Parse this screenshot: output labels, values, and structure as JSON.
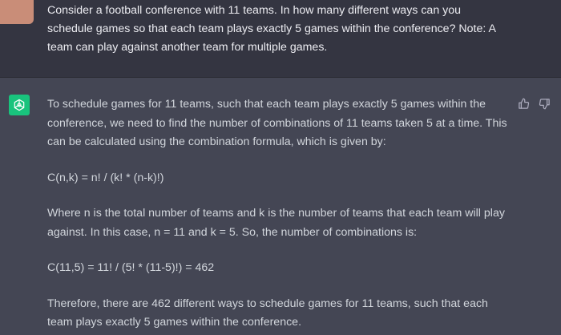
{
  "user_message": {
    "lines": [
      "Consider a football conference with 11 teams. In how many different ways can you",
      "schedule games so that each team plays exactly 5 games within the conference? Note: A",
      "team can play against another team for multiple games."
    ]
  },
  "assistant_message": {
    "paragraphs": [
      "To schedule games for 11 teams, such that each team plays exactly 5 games within the conference, we need to find the number of combinations of 11 teams taken 5 at a time. This can be calculated using the combination formula, which is given by:",
      "C(n,k) = n! / (k! * (n-k)!)",
      "Where n is the total number of teams and k is the number of teams that each team will play against. In this case, n = 11 and k = 5. So, the number of combinations is:",
      "C(11,5) = 11! / (5! * (11-5)!) = 462",
      "Therefore, there are 462 different ways to schedule games for 11 teams, such that each team plays exactly 5 games within the conference."
    ]
  },
  "icons": {
    "assistant_avatar": "openai-logo-icon",
    "thumbs_up": "thumbs-up-icon",
    "thumbs_down": "thumbs-down-icon"
  },
  "colors": {
    "user_bg": "#343541",
    "assistant_bg": "#444654",
    "avatar_green": "#19c37d",
    "user_avatar": "#c98d78"
  }
}
